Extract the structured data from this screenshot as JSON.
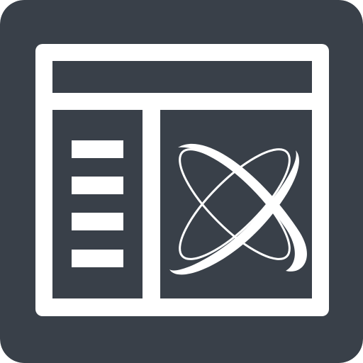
{
  "icon": {
    "name": "app-window-with-atom-icon",
    "tile_color": "#394049",
    "stroke_color": "#ffffff",
    "parts": {
      "window": "window-frame-icon",
      "title_bar": "title-bar-icon",
      "sidebar": "sidebar-panel-icon",
      "content": "content-panel-icon",
      "menu": "menu-lines-icon",
      "atom": "atom-orbit-icon"
    }
  }
}
